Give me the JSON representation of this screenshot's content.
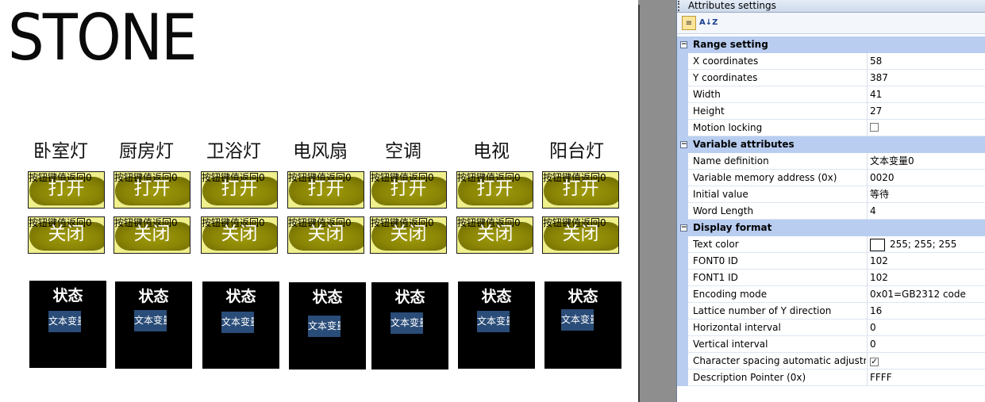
{
  "canvas": {
    "logo": "STONE",
    "devices": [
      {
        "name": "卧室灯",
        "on_small": "按钮键值返回0",
        "on_big": "打开",
        "off_small": "按钮键值返回0",
        "off_big": "关闭",
        "status_label": "状态",
        "var_text": "文本变量"
      },
      {
        "name": "厨房灯",
        "on_small": "按钮键值返回0",
        "on_big": "打开",
        "off_small": "按钮键值返回0",
        "off_big": "关闭",
        "status_label": "状态",
        "var_text": "文本变量"
      },
      {
        "name": "卫浴灯",
        "on_small": "按钮键值返回0",
        "on_big": "打开",
        "off_small": "按钮键值返回0",
        "off_big": "关闭",
        "status_label": "状态",
        "var_text": "文本变量"
      },
      {
        "name": "电风扇",
        "on_small": "按钮键值返回0",
        "on_big": "打开",
        "off_small": "按钮键值返回0",
        "off_big": "关闭",
        "status_label": "状态",
        "var_text": "文本变量"
      },
      {
        "name": "空调",
        "on_small": "按钮键值返回0",
        "on_big": "打开",
        "off_small": "按钮键值返回0",
        "off_big": "关闭",
        "status_label": "状态",
        "var_text": "文本变量"
      },
      {
        "name": "电视",
        "on_small": "按钮键值返回0",
        "on_big": "打开",
        "off_small": "按钮键值返回0",
        "off_big": "关闭",
        "status_label": "状态",
        "var_text": "文本变量"
      },
      {
        "name": "阳台灯",
        "on_small": "按钮键值返回0",
        "on_big": "打开",
        "off_small": "按钮键值返回0",
        "off_big": "关闭",
        "status_label": "状态",
        "var_text": "文本变量"
      }
    ]
  },
  "panel": {
    "title": "Attributes settings",
    "toolbar": {
      "categorized_icon": "categorized-icon",
      "sort_icon": "sort-az-icon",
      "sort_label": "A↓Z"
    },
    "groups": [
      {
        "name": "Range setting",
        "items": [
          {
            "name": "X coordinates",
            "value": "58"
          },
          {
            "name": "Y coordinates",
            "value": "387"
          },
          {
            "name": "Width",
            "value": "41"
          },
          {
            "name": "Height",
            "value": "27"
          },
          {
            "name": "Motion locking",
            "value": "",
            "checkbox": false
          }
        ]
      },
      {
        "name": "Variable attributes",
        "items": [
          {
            "name": "Name definition",
            "value": "文本变量0"
          },
          {
            "name": "Variable memory address (0x)",
            "value": "0020"
          },
          {
            "name": "Initial value",
            "value": "等待"
          },
          {
            "name": "Word Length",
            "value": "4"
          }
        ]
      },
      {
        "name": "Display format",
        "items": [
          {
            "name": "Text color",
            "value": "255; 255; 255",
            "swatch": "#ffffff"
          },
          {
            "name": "FONT0 ID",
            "value": "102"
          },
          {
            "name": "FONT1 ID",
            "value": "102"
          },
          {
            "name": "Encoding mode",
            "value": "0x01=GB2312 code"
          },
          {
            "name": "Lattice number of Y direction",
            "value": "16"
          },
          {
            "name": "Horizontal interval",
            "value": "0"
          },
          {
            "name": "Vertical interval",
            "value": "0"
          },
          {
            "name": "Character spacing automatic adjustment",
            "value": "",
            "checkbox": true,
            "check_mark": "✓"
          },
          {
            "name": "Description Pointer (0x)",
            "value": "FFFF"
          }
        ]
      }
    ]
  },
  "colors": {
    "button_bg": "#efef8c",
    "button_pill": "#8a8505",
    "status_bg": "#000000",
    "var_bg": "#2a4c78",
    "group_bg": "#b8cdf0",
    "workspace": "#8e8e8e"
  }
}
